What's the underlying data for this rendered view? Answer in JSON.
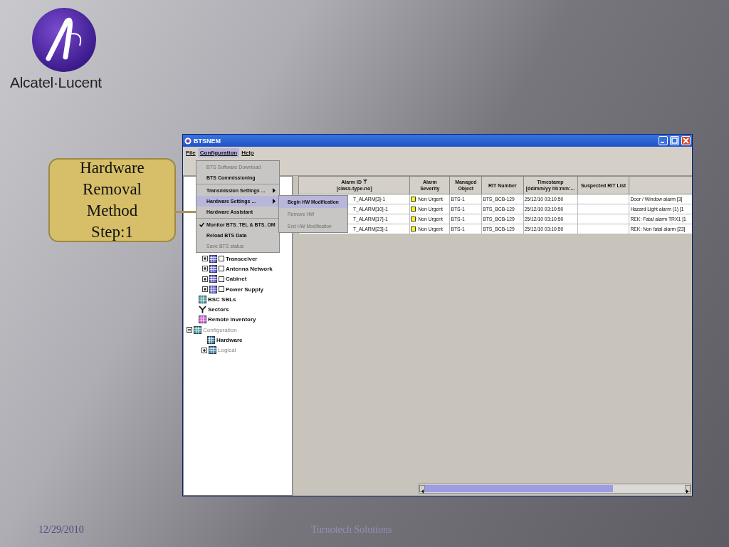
{
  "slide": {
    "brand": "Alcatel·Lucent",
    "callout": "Hardware Removal Method Step:1",
    "footer_date": "12/29/2010",
    "footer_org": "Turnotech Solutions"
  },
  "window": {
    "title": "BTSNEM"
  },
  "menubar": [
    {
      "label": "File",
      "selected": false
    },
    {
      "label": "Configuration",
      "selected": true
    },
    {
      "label": "Help",
      "selected": false
    }
  ],
  "menu": [
    {
      "kind": "item",
      "label": "BTS Software Download",
      "disabled": true,
      "selected": false,
      "checked": false,
      "submenu": false
    },
    {
      "kind": "item",
      "label": "BTS Commissioning",
      "disabled": false,
      "selected": false,
      "checked": false,
      "submenu": false
    },
    {
      "kind": "separator"
    },
    {
      "kind": "item",
      "label": "Transmission Settings ...",
      "disabled": false,
      "selected": false,
      "checked": false,
      "submenu": true
    },
    {
      "kind": "item",
      "label": "Hardware Settings ...",
      "disabled": false,
      "selected": true,
      "checked": false,
      "submenu": true
    },
    {
      "kind": "item",
      "label": "Hardware Assistant",
      "disabled": false,
      "selected": false,
      "checked": false,
      "submenu": false
    },
    {
      "kind": "separator"
    },
    {
      "kind": "item",
      "label": "Monitor BTS_TEL & BTS_OM",
      "disabled": false,
      "selected": false,
      "checked": true,
      "submenu": false
    },
    {
      "kind": "item",
      "label": "Reload BTS Data",
      "disabled": false,
      "selected": false,
      "checked": false,
      "submenu": false
    },
    {
      "kind": "item",
      "label": "Save BTS status",
      "disabled": true,
      "selected": false,
      "checked": false,
      "submenu": false
    }
  ],
  "submenu": [
    {
      "label": "Begin HW Modification",
      "disabled": false,
      "selected": true
    },
    {
      "label": "Remove HW",
      "disabled": true,
      "selected": false
    },
    {
      "label": "End HW Modification",
      "disabled": true,
      "selected": false
    }
  ],
  "tree": {
    "items": [
      {
        "kind": "module",
        "label": "Transceiver",
        "expanded": false,
        "checked": false,
        "disabled": false,
        "color": "#6b6bd6"
      },
      {
        "kind": "module",
        "label": "Antenna Network",
        "expanded": false,
        "checked": false,
        "disabled": false,
        "color": "#6b6bd6"
      },
      {
        "kind": "module",
        "label": "Cabinet",
        "expanded": false,
        "checked": false,
        "disabled": false,
        "color": "#6b6bd6"
      },
      {
        "kind": "module",
        "label": "Power Supply",
        "expanded": false,
        "checked": false,
        "disabled": false,
        "color": "#6b6bd6"
      },
      {
        "kind": "grid",
        "label": "BSC SBLs",
        "disabled": false,
        "color": "#4aa6a6"
      },
      {
        "kind": "antenna",
        "label": "Sectors",
        "disabled": false
      },
      {
        "kind": "grid",
        "label": "Remote Inventory",
        "disabled": false,
        "color": "#d65fd6"
      },
      {
        "kind": "folder",
        "label": "Configuration",
        "expanded": true,
        "disabled": true,
        "color": "#4aa6a6",
        "children": [
          {
            "kind": "grid",
            "label": "Hardware",
            "disabled": false,
            "color": "#4a8fb0"
          },
          {
            "kind": "folder",
            "label": "Logical",
            "expanded": false,
            "disabled": true,
            "color": "#4a8fb0"
          }
        ]
      }
    ]
  },
  "table": {
    "columns": [
      {
        "label": "Alarm ID",
        "sub": "[class-type-no]",
        "filter": true
      },
      {
        "label": "Alarm",
        "sub": "Severity",
        "filter": false
      },
      {
        "label": "Managed",
        "sub": "Object",
        "filter": false
      },
      {
        "label": "RIT Number",
        "filter": false
      },
      {
        "label": "Timestamp",
        "sub": "[dd/mm/yy hh:mm:...",
        "filter": false
      },
      {
        "label": "Suspected RIT List",
        "filter": false
      },
      {
        "filter": false
      }
    ],
    "rows": [
      {
        "alarm_id": "T_ALARM[3]-1",
        "severity": "Non Urgent",
        "color": "#ffff00",
        "object": "BTS-1",
        "rit": "BTS_BCB-129",
        "timestamp": "25/12/10 03:10:50",
        "column_7": "Door / Window alarm [3]"
      },
      {
        "alarm_id": "T_ALARM[10]-1",
        "severity": "Non Urgent",
        "color": "#ffff00",
        "object": "BTS-1",
        "rit": "BTS_BCB-129",
        "timestamp": "25/12/10 03:10:50",
        "column_7": "Hazard Light alarm (1) [1"
      },
      {
        "alarm_id": "T_ALARM[17]-1",
        "severity": "Non Urgent",
        "color": "#ffff00",
        "object": "BTS-1",
        "rit": "BTS_BCB-129",
        "timestamp": "25/12/10 03:10:50",
        "column_7": "REK: Fatal alarm TRX1 [1"
      },
      {
        "alarm_id": "T_ALARM[23]-1",
        "severity": "Non Urgent",
        "color": "#ffff00",
        "object": "BTS-1",
        "rit": "BTS_BCB-129",
        "timestamp": "25/12/10 03:10:50",
        "column_7": "REK: Non fatal alarm [23]"
      }
    ]
  }
}
